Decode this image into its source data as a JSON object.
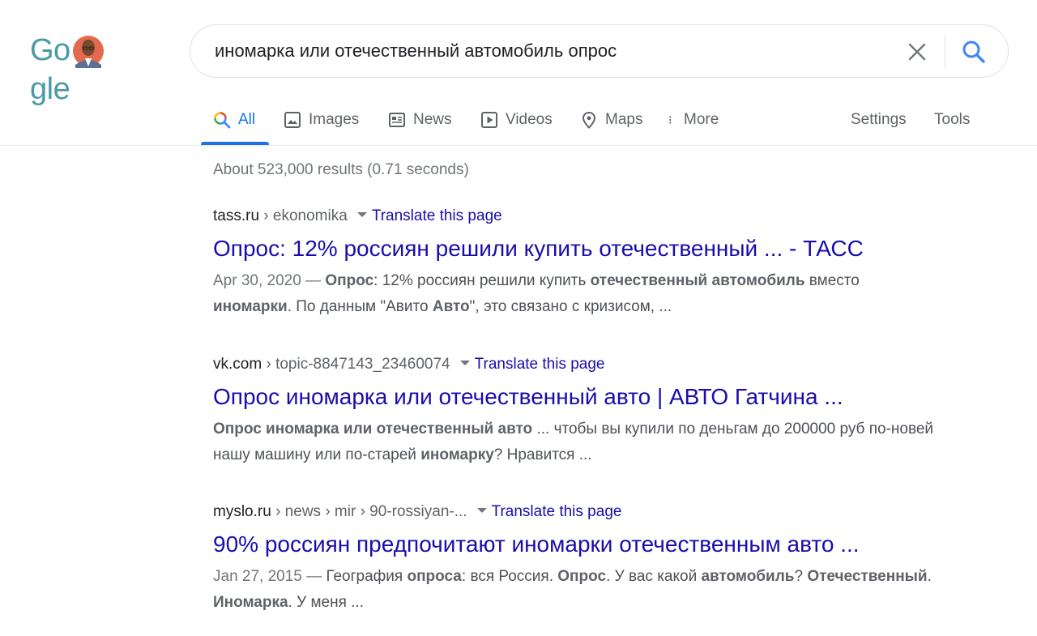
{
  "logo": {
    "text_left": "Go",
    "text_right": "gle"
  },
  "search": {
    "query": "иномарка или отечественный автомобиль опрос"
  },
  "tabs": [
    {
      "label": "All",
      "icon": "search-multicolor-icon"
    },
    {
      "label": "Images",
      "icon": "image-icon"
    },
    {
      "label": "News",
      "icon": "news-icon"
    },
    {
      "label": "Videos",
      "icon": "video-icon"
    },
    {
      "label": "Maps",
      "icon": "map-pin-icon"
    },
    {
      "label": "More",
      "icon": "more-vert-icon"
    },
    {
      "label": "Settings"
    },
    {
      "label": "Tools"
    }
  ],
  "stats": "About 523,000 results (0.71 seconds)",
  "results": [
    {
      "domain": "tass.ru",
      "path": " › ekonomika",
      "translate": "Translate this page",
      "title": "Опрос: 12% россиян решили купить отечественный ... - ТАСС",
      "date": "Apr 30, 2020 — ",
      "snippet": [
        {
          "t": "Опрос",
          "b": true
        },
        {
          "t": ": 12% россиян решили купить ",
          "b": false
        },
        {
          "t": "отечественный автомобиль",
          "b": true
        },
        {
          "t": " вместо ",
          "b": false
        },
        {
          "t": "иномарки",
          "b": true
        },
        {
          "t": ". По данным \"Авито ",
          "b": false
        },
        {
          "t": "Авто",
          "b": true
        },
        {
          "t": "\", это связано с кризисом, ...",
          "b": false
        }
      ]
    },
    {
      "domain": "vk.com",
      "path": " › topic-8847143_23460074",
      "translate": "Translate this page",
      "title": "Опрос иномарка или отечественный авто | АВТО Гатчина ...",
      "date": "",
      "snippet": [
        {
          "t": "Опрос иномарка или отечественный авто",
          "b": true
        },
        {
          "t": " ... чтобы вы купили по деньгам до 200000 руб по-новей нашу машину или по-старей ",
          "b": false
        },
        {
          "t": "иномарку",
          "b": true
        },
        {
          "t": "? Нравится ...",
          "b": false
        }
      ]
    },
    {
      "domain": "myslo.ru",
      "path": " › news › mir › 90-rossiyan-...",
      "translate": "Translate this page",
      "title": "90% россиян предпочитают иномарки отечественным авто ...",
      "date": "Jan 27, 2015 — ",
      "snippet": [
        {
          "t": "География ",
          "b": false
        },
        {
          "t": "опроса",
          "b": true
        },
        {
          "t": ": вся Россия. ",
          "b": false
        },
        {
          "t": "Опрос",
          "b": true
        },
        {
          "t": ". У вас какой ",
          "b": false
        },
        {
          "t": "автомобиль",
          "b": true
        },
        {
          "t": "? ",
          "b": false
        },
        {
          "t": "Отечественный",
          "b": true
        },
        {
          "t": ". ",
          "b": false
        },
        {
          "t": "Иномарка",
          "b": true
        },
        {
          "t": ". У меня ...",
          "b": false
        }
      ]
    }
  ]
}
